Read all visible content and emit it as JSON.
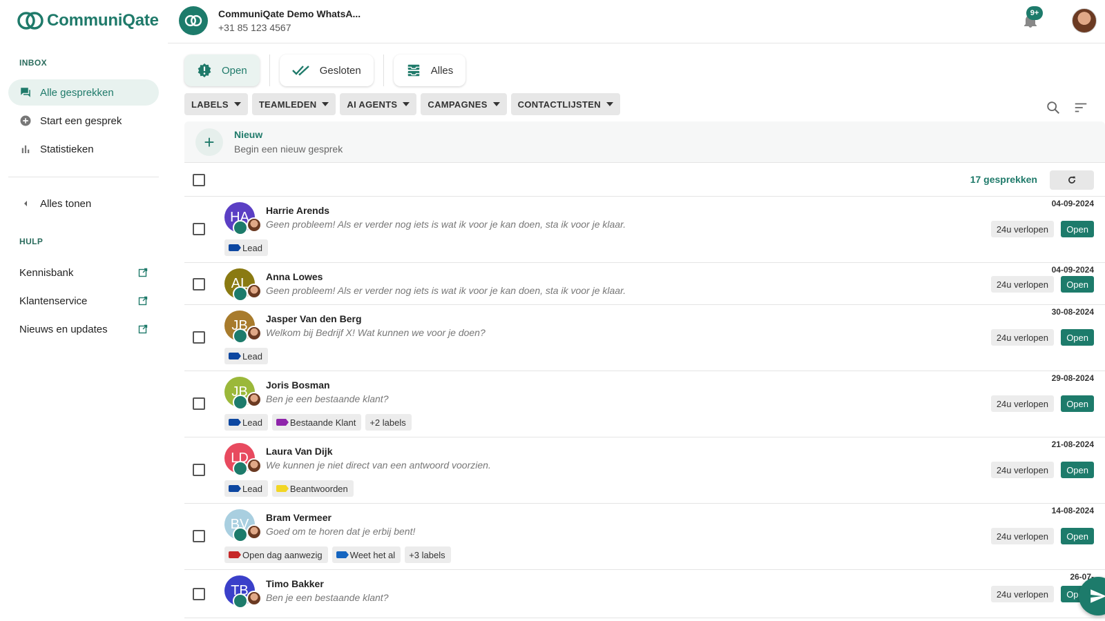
{
  "brand": {
    "name": "CommuniQate",
    "color": "#1d7b6b"
  },
  "sidebar": {
    "inbox_label": "INBOX",
    "nav": [
      {
        "label": "Alle gesprekken",
        "icon": "chat-icon",
        "active": true
      },
      {
        "label": "Start een gesprek",
        "icon": "add-circle-icon"
      },
      {
        "label": "Statistieken",
        "icon": "bar-chart-icon"
      }
    ],
    "show_all": "Alles tonen",
    "help_label": "HULP",
    "help": [
      {
        "label": "Kennisbank",
        "icon": "external-link-icon"
      },
      {
        "label": "Klantenservice",
        "icon": "external-link-icon"
      },
      {
        "label": "Nieuws en updates",
        "icon": "external-link-icon"
      }
    ]
  },
  "header": {
    "account_name": "CommuniQate Demo WhatsA...",
    "account_phone": "+31 85 123 4567",
    "notification_badge": "9+"
  },
  "status_tabs": [
    {
      "label": "Open",
      "icon": "alert-badge-icon",
      "active": true
    },
    {
      "label": "Gesloten",
      "icon": "double-check-icon"
    },
    {
      "label": "Alles",
      "icon": "inbox-icon"
    }
  ],
  "filters": [
    "LABELS",
    "TEAMLEDEN",
    "AI AGENTS",
    "CAMPAGNES",
    "CONTACTLIJSTEN"
  ],
  "new_conversation": {
    "title": "Nieuw",
    "subtitle": "Begin een nieuw gesprek"
  },
  "list": {
    "count": "17 gesprekken"
  },
  "conversations": [
    {
      "initials": "HA",
      "color": "#5b3fc4",
      "name": "Harrie Arends",
      "message": "Geen probleem! Als er verder nog iets is wat ik voor je kan doen, sta ik voor je klaar.",
      "date": "04-09-2024",
      "expire": "24u verlopen",
      "status": "Open",
      "labels": [
        {
          "text": "Lead",
          "color": "#0d47a1"
        }
      ]
    },
    {
      "initials": "AL",
      "color": "#8a7a12",
      "name": "Anna Lowes",
      "message": "Geen probleem! Als er verder nog iets is wat ik voor je kan doen, sta ik voor je klaar.",
      "date": "04-09-2024",
      "expire": "24u verlopen",
      "status": "Open",
      "labels": []
    },
    {
      "initials": "JB",
      "color": "#a87b2c",
      "name": "Jasper Van den Berg",
      "message": "Welkom bij Bedrijf X! Wat kunnen we voor je doen?",
      "date": "30-08-2024",
      "expire": "24u verlopen",
      "status": "Open",
      "labels": [
        {
          "text": "Lead",
          "color": "#0d47a1"
        }
      ]
    },
    {
      "initials": "JB",
      "color": "#9bb83a",
      "name": "Joris Bosman",
      "message": "Ben je een bestaande klant?",
      "date": "29-08-2024",
      "expire": "24u verlopen",
      "status": "Open",
      "labels": [
        {
          "text": "Lead",
          "color": "#0d47a1"
        },
        {
          "text": "Bestaande Klant",
          "color": "#8e24aa"
        },
        {
          "text": "+2 labels",
          "color": ""
        }
      ]
    },
    {
      "initials": "LD",
      "color": "#e84a5f",
      "name": "Laura Van Dijk",
      "message": "We kunnen je niet direct van een antwoord voorzien.",
      "date": "21-08-2024",
      "expire": "24u verlopen",
      "status": "Open",
      "labels": [
        {
          "text": "Lead",
          "color": "#0d47a1"
        },
        {
          "text": "Beantwoorden",
          "color": "#f2d624"
        }
      ]
    },
    {
      "initials": "BV",
      "color": "#a9cfe0",
      "name": "Bram Vermeer",
      "message": "Goed om te horen dat je erbij bent!",
      "date": "14-08-2024",
      "expire": "24u verlopen",
      "status": "Open",
      "labels": [
        {
          "text": "Open dag aanwezig",
          "color": "#c62828"
        },
        {
          "text": "Weet het al",
          "color": "#1565c0"
        },
        {
          "text": "+3 labels",
          "color": ""
        }
      ]
    },
    {
      "initials": "TB",
      "color": "#3a3fc9",
      "name": "Timo Bakker",
      "message": "Ben je een bestaande klant?",
      "date": "26-07-",
      "expire": "24u verlopen",
      "status": "Open",
      "labels": []
    }
  ]
}
